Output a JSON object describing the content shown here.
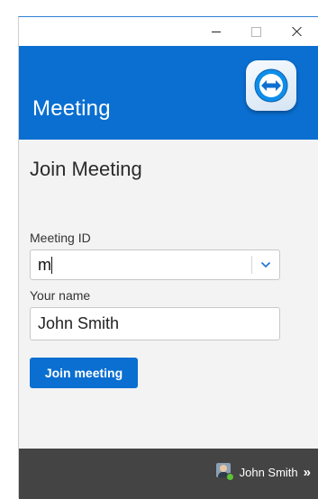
{
  "window": {
    "controls": {
      "minimize_icon": "minimize-icon",
      "maximize_icon": "maximize-icon",
      "close_icon": "close-icon"
    }
  },
  "header": {
    "title": "Meeting",
    "logo_icon": "teamviewer-logo-icon",
    "background_color": "#0a6fd1"
  },
  "main": {
    "section_title": "Join Meeting",
    "meeting_id": {
      "label": "Meeting ID",
      "value": "m"
    },
    "your_name": {
      "label": "Your name",
      "value": "John Smith"
    },
    "join_button_label": "Join meeting"
  },
  "footer": {
    "user_name": "John Smith",
    "chevron": "»",
    "presence_color": "#5cc236"
  }
}
